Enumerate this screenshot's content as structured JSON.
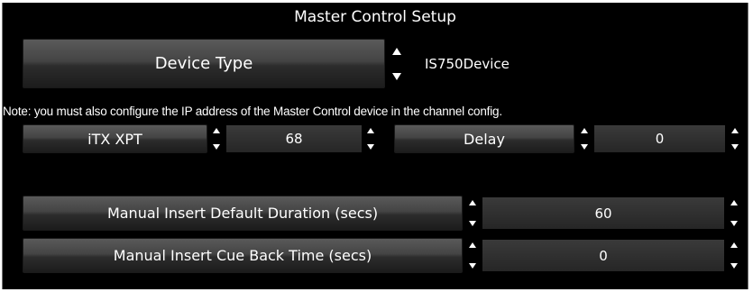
{
  "window": {
    "title": "Master Control Setup"
  },
  "device_type": {
    "label": "Device Type",
    "value": "IS750Device"
  },
  "note": "Note: you must also configure the IP address of the Master Control device in the channel config.",
  "itx_xpt": {
    "label": "iTX XPT",
    "value": "68"
  },
  "delay": {
    "label": "Delay",
    "value": "0"
  },
  "manual_insert_default_duration": {
    "label": "Manual Insert Default Duration (secs)",
    "value": "60"
  },
  "manual_insert_cue_back_time": {
    "label": "Manual Insert Cue Back Time (secs)",
    "value": "0"
  }
}
